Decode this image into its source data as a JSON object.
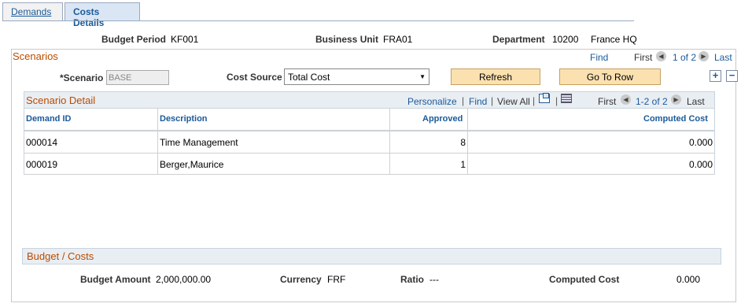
{
  "tabs": [
    {
      "label": "Demands"
    },
    {
      "label": "Costs Details"
    }
  ],
  "header": {
    "budget_period_label": "Budget Period",
    "budget_period_value": "KF001",
    "business_unit_label": "Business Unit",
    "business_unit_value": "FRA01",
    "department_label": "Department",
    "department_code": "10200",
    "department_name": "France HQ"
  },
  "scenarios": {
    "title": "Scenarios",
    "find": "Find",
    "first": "First",
    "count": "1 of 2",
    "last": "Last",
    "scenario_label": "*Scenario",
    "scenario_value": "BASE",
    "cost_source_label": "Cost Source",
    "cost_source_value": "Total Cost",
    "refresh_label": "Refresh",
    "goto_label": "Go To Row",
    "add_symbol": "+",
    "remove_symbol": "−"
  },
  "detail": {
    "title": "Scenario Detail",
    "personalize": "Personalize",
    "sep1": "|",
    "find": "Find",
    "sep2": "|",
    "view_all": "View All",
    "sep3": "|",
    "sep4": "|",
    "first": "First",
    "count": "1-2 of 2",
    "last": "Last",
    "columns": [
      "Demand ID",
      "Description",
      "Approved",
      "Computed Cost"
    ],
    "rows": [
      {
        "id": "000014",
        "description": "Time Management",
        "approved": "8",
        "cost": "0.000"
      },
      {
        "id": "000019",
        "description": "Berger,Maurice",
        "approved": "1",
        "cost": "0.000"
      }
    ]
  },
  "budget": {
    "title": "Budget / Costs",
    "amount_label": "Budget Amount",
    "amount_value": "2,000,000.00",
    "currency_label": "Currency",
    "currency_value": "FRF",
    "ratio_label": "Ratio",
    "ratio_value": "---",
    "computed_label": "Computed Cost",
    "computed_value": "0.000"
  },
  "icons": {
    "prev": "◀",
    "next": "▶",
    "dropdown": "▼"
  }
}
